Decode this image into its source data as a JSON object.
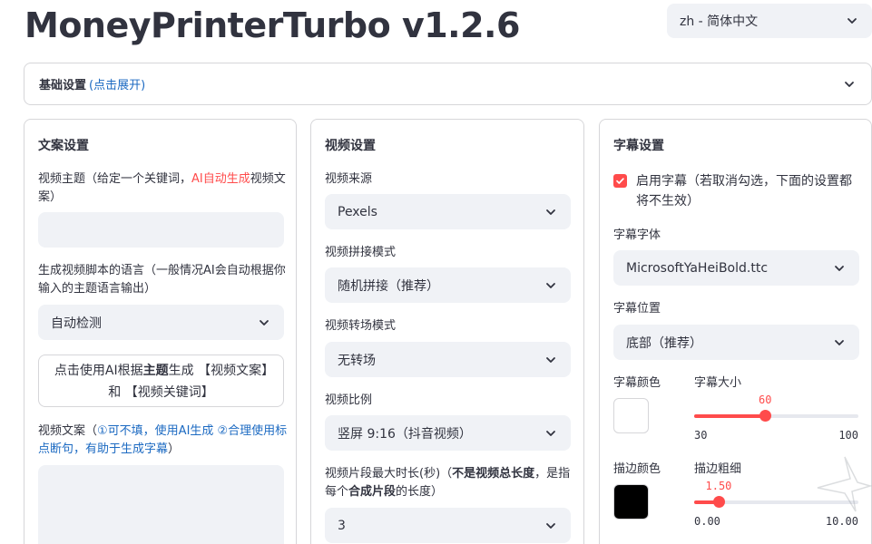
{
  "app": {
    "title": "MoneyPrinterTurbo v1.2.6"
  },
  "language_select": {
    "value": "zh - 简体中文"
  },
  "basic_settings": {
    "label": "基础设置",
    "hint": "(点击展开)"
  },
  "script_panel": {
    "heading": "文案设置",
    "subject_label": {
      "part1": "视频主题（给定一个关键词，",
      "highlight": "AI自动生成",
      "part2": "视频文案）"
    },
    "subject_value": "",
    "language_label": "生成视频脚本的语言（一般情况AI会自动根据你输入的主题语言输出）",
    "language_value": "自动检测",
    "generate_button": {
      "part1": "点击使用AI根据",
      "bold": "主题",
      "part2": "生成 【视频文案】和 【视频关键词】"
    },
    "script_label": {
      "part1": "视频文案（",
      "hint": "①可不填，使用AI生成 ②合理使用标点断句，有助于生成字幕",
      "part2": "）"
    },
    "script_value": ""
  },
  "video_panel": {
    "heading": "视频设置",
    "source_label": "视频来源",
    "source_value": "Pexels",
    "concat_label": "视频拼接模式",
    "concat_value": "随机拼接（推荐）",
    "transition_label": "视频转场模式",
    "transition_value": "无转场",
    "ratio_label": "视频比例",
    "ratio_value": "竖屏 9:16（抖音视频）",
    "clip_label": {
      "part1": "视频片段最大时长(秒)（",
      "bold1": "不是视频总长度",
      "part2": "，是指每个",
      "bold2": "合成片段",
      "part3": "的长度）"
    },
    "clip_value": "3"
  },
  "subtitle_panel": {
    "heading": "字幕设置",
    "enable_label": "启用字幕（若取消勾选，下面的设置都将不生效）",
    "enable_checked": true,
    "font_label": "字幕字体",
    "font_value": "MicrosoftYaHeiBold.ttc",
    "position_label": "字幕位置",
    "position_value": "底部（推荐）",
    "color_label": "字幕颜色",
    "color_value": "#ffffff",
    "size_label": "字幕大小",
    "size_slider": {
      "value": "60",
      "min": "30",
      "max": "100",
      "fraction": 0.4286
    },
    "stroke_color_label": "描边颜色",
    "stroke_color_value": "#000000",
    "stroke_width_label": "描边粗细",
    "stroke_slider": {
      "value": "1.50",
      "min": "0.00",
      "max": "10.00",
      "fraction": 0.15
    }
  },
  "theme": {
    "accent": "#ff4b4b",
    "link": "#1c6ac2",
    "input_bg": "#f0f2f6",
    "border": "#d6d6d9",
    "text": "#31333f"
  }
}
